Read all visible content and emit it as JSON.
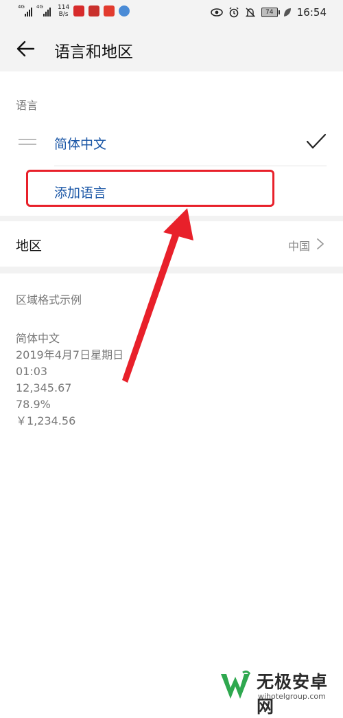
{
  "status_bar": {
    "network_tag_1": "4G",
    "network_tag_2": "4G",
    "speed_value": "114",
    "speed_unit": "B/s",
    "battery": "74",
    "time": "16:54",
    "icons": [
      "signal-icon",
      "signal-icon",
      "app-icon",
      "app-icon",
      "app-icon",
      "app-icon",
      "eye-icon",
      "alarm-icon",
      "mute-icon",
      "battery-icon",
      "leaf-icon"
    ]
  },
  "header": {
    "title": "语言和地区",
    "back_icon": "back-arrow-icon"
  },
  "language_section": {
    "label": "语言",
    "current_language": "简体中文",
    "add_language": "添加语言"
  },
  "region": {
    "label": "地区",
    "value": "中国"
  },
  "format_example": {
    "label": "区域格式示例",
    "lines": [
      "简体中文",
      "2019年4月7日星期日",
      "01:03",
      "12,345.67",
      "78.9%",
      "￥1,234.56"
    ]
  },
  "annotation": {
    "highlight_color": "#e8202a"
  },
  "watermark": {
    "name": "无极安卓网",
    "url": "wjhotelgroup.com"
  }
}
